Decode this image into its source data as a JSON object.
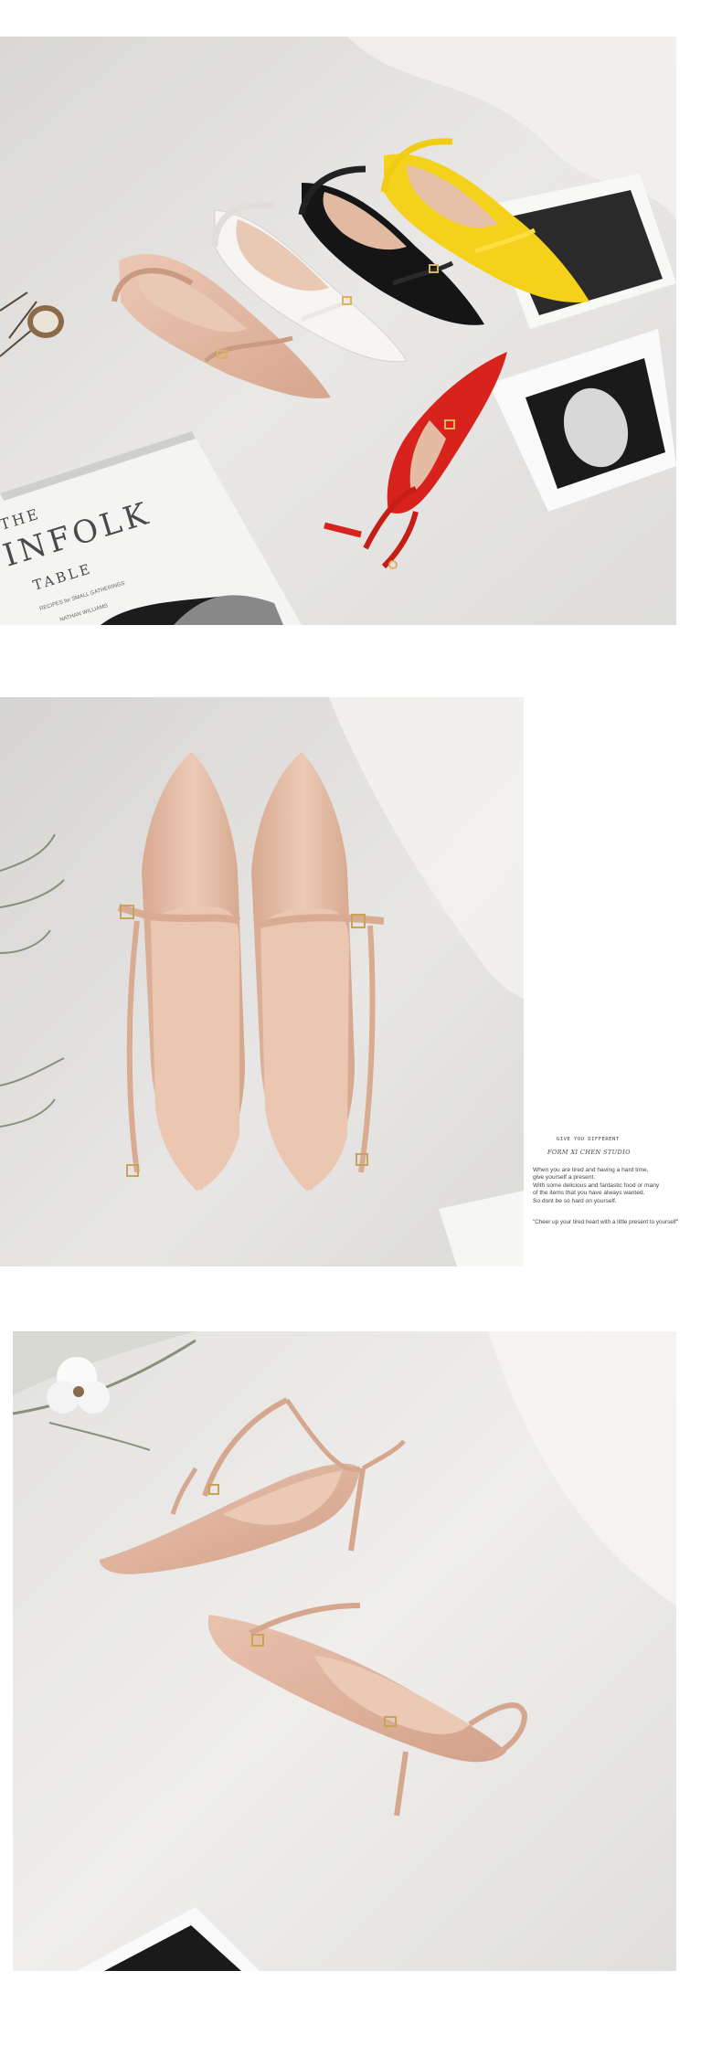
{
  "photos": {
    "photo1": {
      "subject": "shoes-five-colors",
      "book_lines": [
        "THE",
        "INFOLK",
        "TABLE"
      ],
      "book_small": [
        "RECIPES for SMALL GATHERINGS",
        "NATHAN WILLIAMS"
      ]
    },
    "photo2": {
      "subject": "nude-pair-top-view"
    },
    "photo3": {
      "subject": "nude-pair-side-view"
    }
  },
  "side_text": {
    "small_caption": "GIVE YOU DIFFERENT",
    "studio": "FORM XI CHEN STUDIO",
    "paragraph": [
      "When you are tired and having a hard time,",
      "give yourself a present.",
      "With some delicious and fantastic food or many",
      "of the items that you have always wanted.",
      "So dont be so hard on yourself."
    ],
    "quote": "\"Cheer up your tired heart with a little present to yourself\""
  },
  "colors": {
    "nude": "#e2b8a2",
    "white": "#f7f5f3",
    "black": "#151515",
    "yellow": "#f4d21c",
    "red": "#d8231d",
    "backdrop": "#e7e6e4"
  }
}
